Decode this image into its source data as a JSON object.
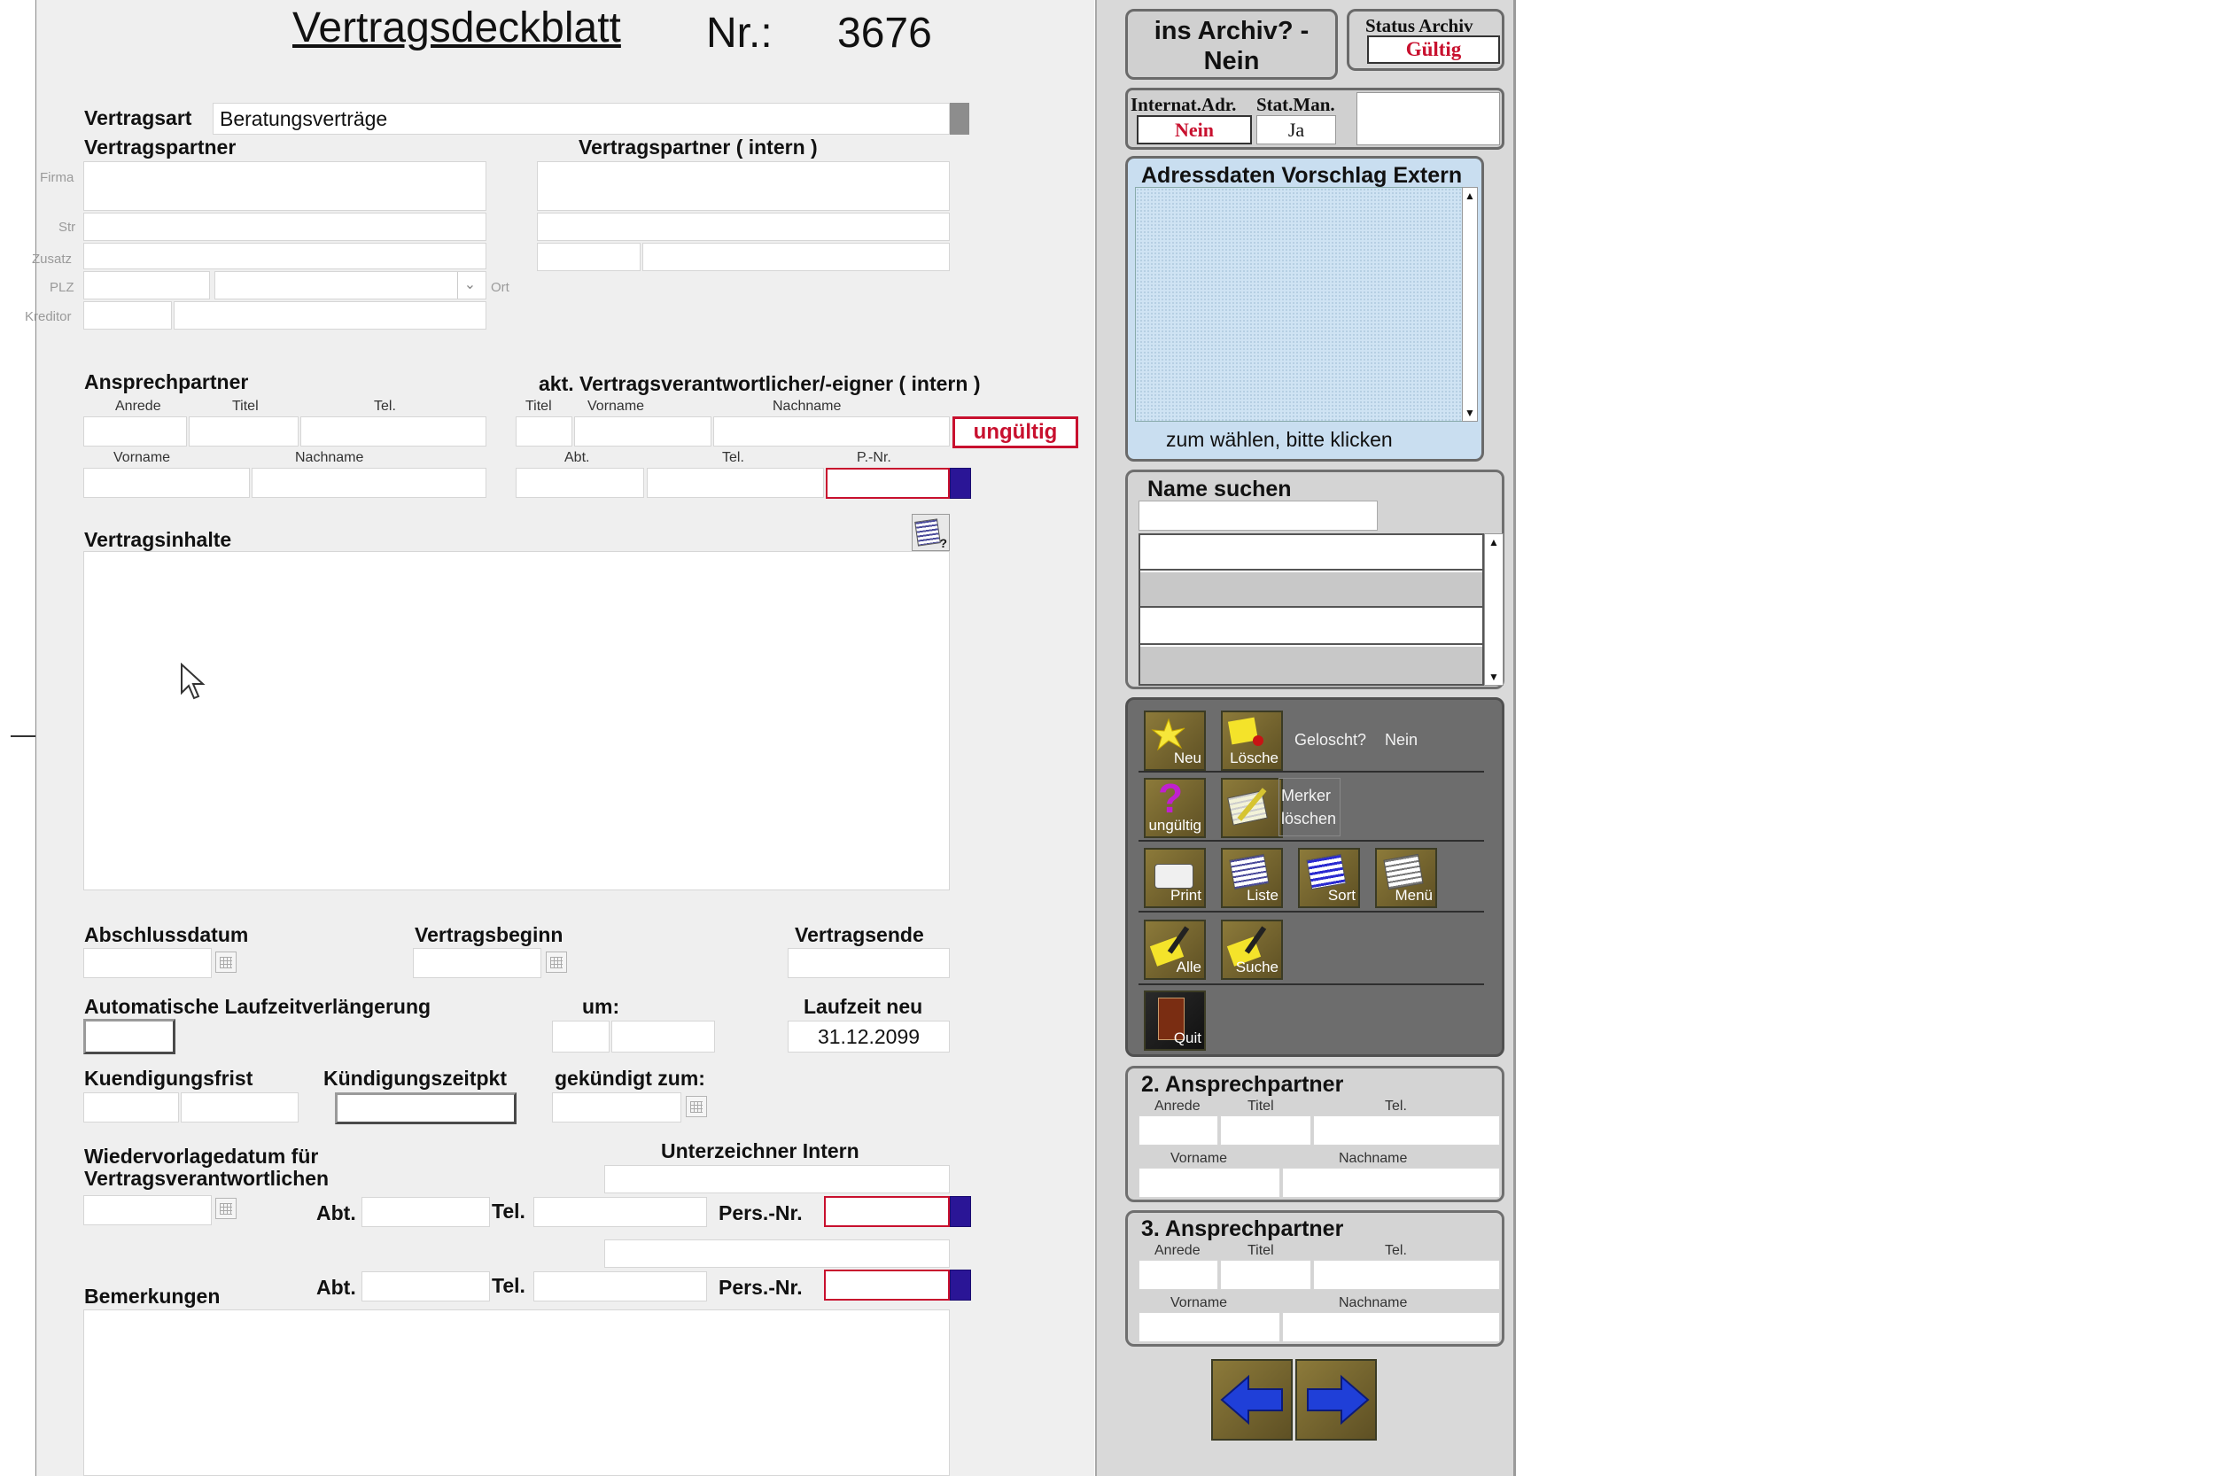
{
  "header": {
    "title": "Vertragsdeckblatt",
    "nr_label": "Nr.:",
    "nr_value": "3676"
  },
  "vertragsart": {
    "label": "Vertragsart",
    "value": "Beratungsverträge"
  },
  "partner": {
    "extern_heading": "Vertragspartner",
    "intern_heading": "Vertragspartner ( intern )",
    "side_labels": {
      "firma": "Firma",
      "str": "Str",
      "zusatz": "Zusatz",
      "plz": "PLZ",
      "kreditor": "Kreditor",
      "ort": "Ort"
    }
  },
  "ansprech": {
    "heading": "Ansprechpartner",
    "cols1": [
      "Anrede",
      "Titel",
      "Tel."
    ],
    "cols2": [
      "Vorname",
      "Nachname"
    ]
  },
  "verantwortlich": {
    "heading": "akt. Vertragsverantwortlicher/-eigner  ( intern )",
    "cols1": [
      "Titel",
      "Vorname",
      "Nachname"
    ],
    "cols2": [
      "Abt.",
      "Tel.",
      "P.-Nr."
    ],
    "status_badge": "ungültig"
  },
  "inhalte": {
    "heading": "Vertragsinhalte"
  },
  "dates": {
    "abschluss": "Abschlussdatum",
    "beginn": "Vertragsbeginn",
    "ende": "Vertragsende"
  },
  "laufzeit": {
    "auto_label": "Automatische Laufzeitverlängerung",
    "um_label": "um:",
    "neu_label": "Laufzeit neu",
    "neu_value": "31.12.2099"
  },
  "kuendigung": {
    "frist_label": "Kuendigungsfrist",
    "zeitpkt_label": "Kündigungszeitpkt",
    "gekuendigt_label": "gekündigt zum:"
  },
  "wiedervorlage": {
    "label_line1": "Wiedervorlagedatum für",
    "label_line2": "Vertragsverantwortlichen"
  },
  "unterzeichner": {
    "heading": "Unterzeichner Intern",
    "abt": "Abt.",
    "tel": "Tel.",
    "pers": "Pers.-Nr."
  },
  "bemerkungen": {
    "heading": "Bemerkungen"
  },
  "sidebar": {
    "archiv_button": "ins Archiv? - Nein",
    "status_label": "Status Archiv",
    "status_value": "Gültig",
    "internat_label": "Internat.Adr.",
    "internat_value": "Nein",
    "statman_label": "Stat.Man.",
    "statman_value": "Ja",
    "adress_heading": "Adressdaten Vorschlag Extern",
    "adress_hint": "zum wählen, bitte klicken",
    "name_search_heading": "Name suchen",
    "toolbar": {
      "neu": "Neu",
      "loesche": "Lösche",
      "geloescht_label": "Geloscht?",
      "geloescht_value": "Nein",
      "ungueltig": "ungültig",
      "merker": "Merker löschen",
      "print": "Print",
      "liste": "Liste",
      "sort": "Sort",
      "menue": "Menü",
      "alle": "Alle",
      "suche": "Suche",
      "quit": "Quit"
    },
    "ansprech2": {
      "heading": "2. Ansprechpartner",
      "anrede": "Anrede",
      "titel": "Titel",
      "tel": "Tel.",
      "vorname": "Vorname",
      "nachname": "Nachname"
    },
    "ansprech3": {
      "heading": "3. Ansprechpartner",
      "anrede": "Anrede",
      "titel": "Titel",
      "tel": "Tel.",
      "vorname": "Vorname",
      "nachname": "Nachname"
    }
  },
  "colors": {
    "accent_red": "#c8102e",
    "pnr_blue": "#2a1596",
    "panel_gray": "#d9d9d9",
    "toolbar_gray": "#6d6d6d"
  }
}
